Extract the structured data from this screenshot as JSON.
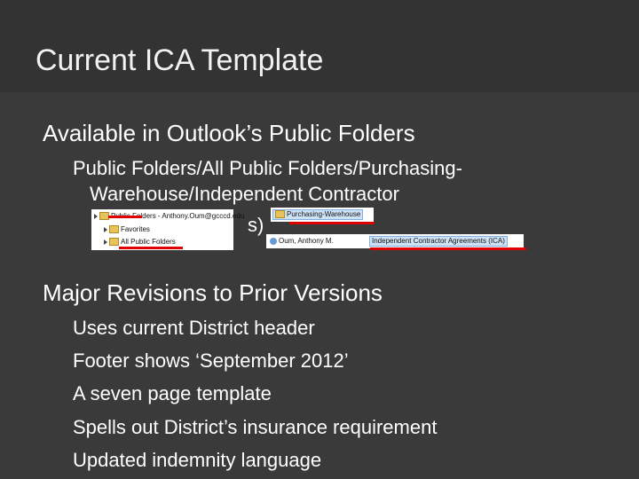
{
  "slide": {
    "title": "Current ICA Template",
    "bullet_glyph": "",
    "sections": [
      {
        "heading": "Available in Outlook’s Public Folders",
        "sub_line1": "Public Folders/All Public Folders/Purchasing-",
        "sub_line2": "Warehouse/Independent Contractor",
        "sub_line3_fragment": "s)"
      },
      {
        "heading": "Major Revisions to Prior Versions",
        "items": [
          "Uses current District header",
          "Footer shows ‘September 2012’",
          "A seven page template",
          "Spells out District’s insurance requirement",
          "Updated indemnity language"
        ]
      }
    ],
    "snippets": {
      "left": {
        "row1": "Public Folders - Anthony.Oum@gcccd.edu",
        "row2": "Favorites",
        "row3": "All Public Folders"
      },
      "mid": {
        "label": "Purchasing-Warehouse"
      },
      "right": {
        "user": "Oum, Anthony M.",
        "folder": "Independent Contractor Agreements (ICA)"
      }
    },
    "colors": {
      "background": "#3a3a3a",
      "text": "#ffffff",
      "underline": "#e00000"
    }
  }
}
